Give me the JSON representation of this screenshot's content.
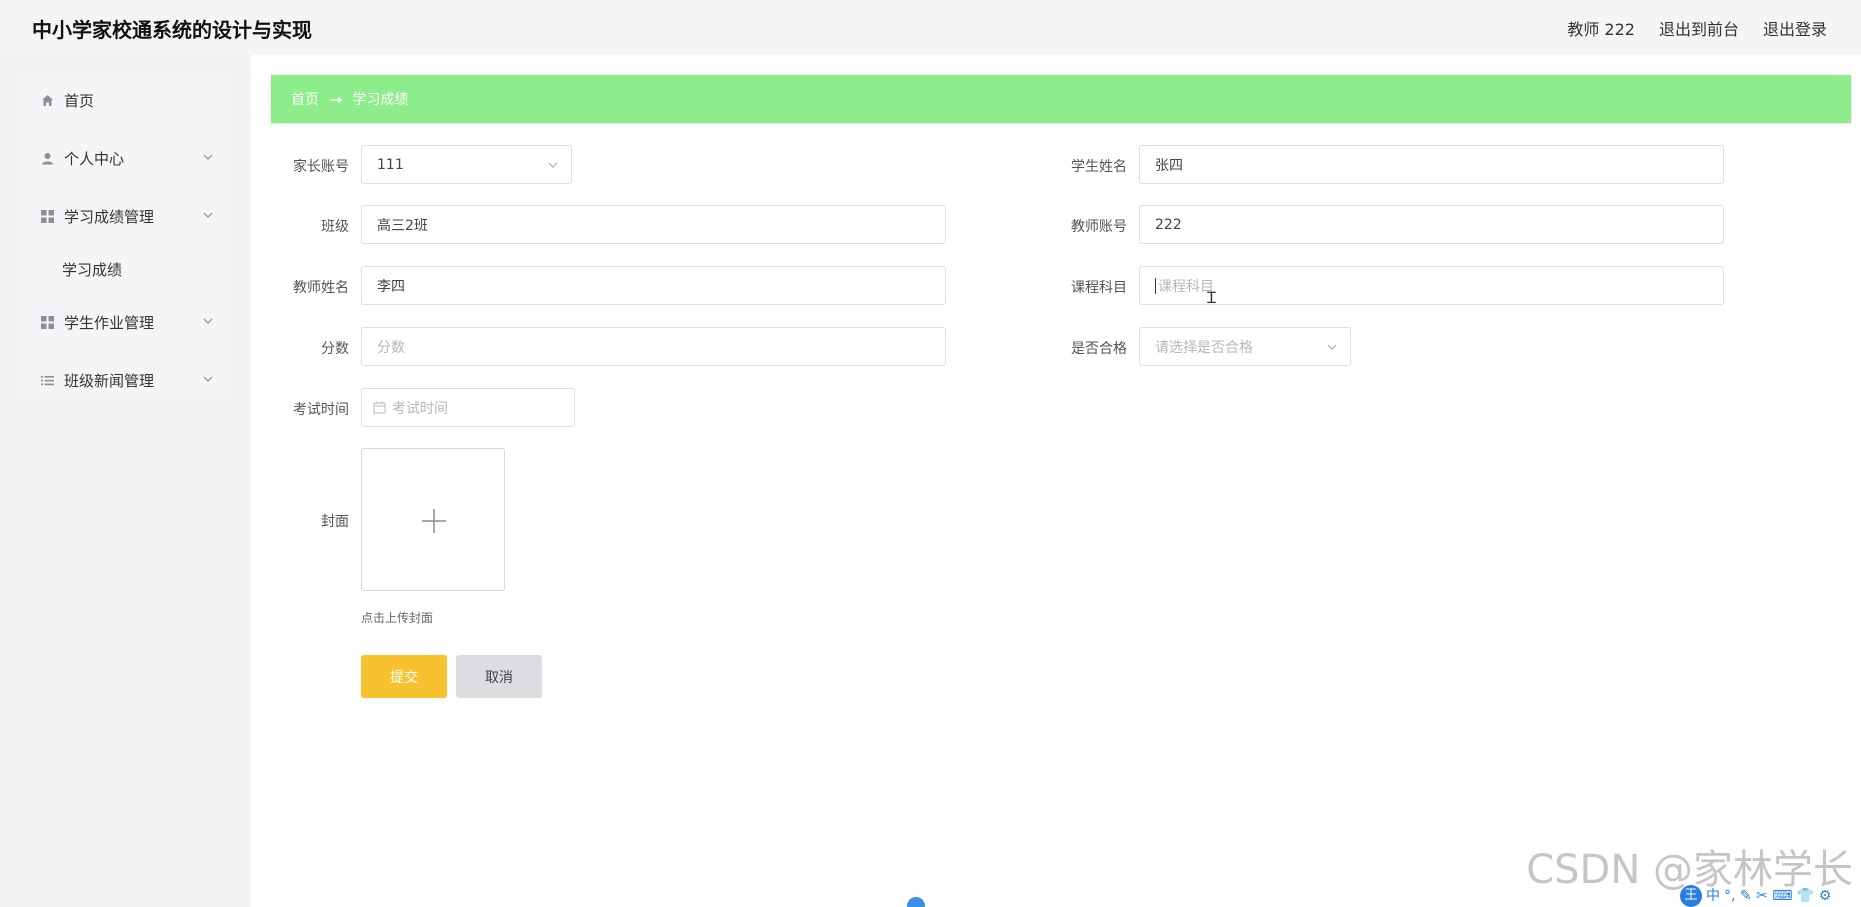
{
  "header": {
    "app_title": "中小学家校通系统的设计与实现",
    "user_label": "教师 222",
    "back_front_label": "退出到前台",
    "logout_label": "退出登录"
  },
  "sidebar": {
    "items": [
      {
        "label": "首页",
        "icon": "home-icon"
      },
      {
        "label": "个人中心",
        "icon": "user-icon"
      },
      {
        "label": "学习成绩管理",
        "icon": "grid-icon"
      },
      {
        "label": "学习成绩",
        "icon": ""
      },
      {
        "label": "学生作业管理",
        "icon": "grid-icon"
      },
      {
        "label": "班级新闻管理",
        "icon": "list-icon"
      }
    ]
  },
  "breadcrumb": {
    "home": "首页",
    "arrow": "→",
    "current": "学习成绩"
  },
  "form": {
    "parent_account": {
      "label": "家长账号",
      "value": "111"
    },
    "student_name": {
      "label": "学生姓名",
      "value": "张四"
    },
    "class": {
      "label": "班级",
      "value": "高三2班"
    },
    "teacher_account": {
      "label": "教师账号",
      "value": "222"
    },
    "teacher_name": {
      "label": "教师姓名",
      "value": "李四"
    },
    "course": {
      "label": "课程科目",
      "placeholder": "课程科目"
    },
    "score": {
      "label": "分数",
      "placeholder": "分数"
    },
    "passed": {
      "label": "是否合格",
      "placeholder": "请选择是否合格"
    },
    "exam_time": {
      "label": "考试时间",
      "placeholder": "考试时间"
    },
    "cover": {
      "label": "封面",
      "hint": "点击上传封面"
    },
    "submit_label": "提交",
    "cancel_label": "取消"
  },
  "overlay": {
    "watermark": "CSDN @家林学长",
    "ime_logo": "王",
    "ime_mode": "中",
    "ime_symbols": "°, ✎ ✂ ⌨ 👕 ⚙"
  },
  "colors": {
    "breadcrumb_bg": "#8ded8b",
    "submit_bg": "#f6c22f",
    "cancel_bg": "#dcdde0"
  }
}
